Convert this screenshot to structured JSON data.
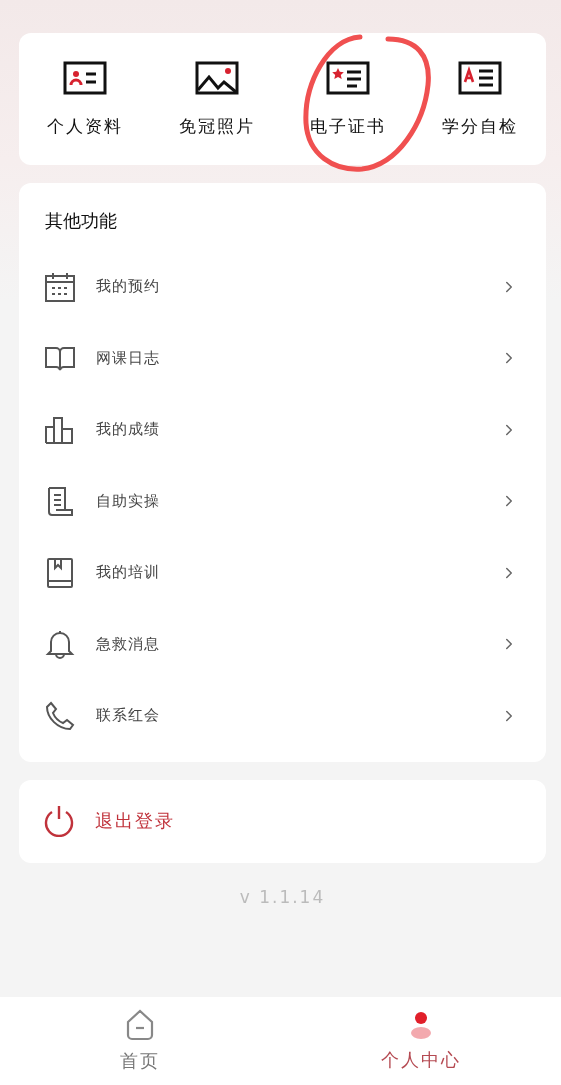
{
  "quick_actions": [
    {
      "label": "个人资料",
      "circled": false
    },
    {
      "label": "免冠照片",
      "circled": false
    },
    {
      "label": "电子证书",
      "circled": true
    },
    {
      "label": "学分自检",
      "circled": false
    }
  ],
  "other_functions": {
    "title": "其他功能",
    "items": [
      {
        "label": "我的预约"
      },
      {
        "label": "网课日志"
      },
      {
        "label": "我的成绩"
      },
      {
        "label": "自助实操"
      },
      {
        "label": "我的培训"
      },
      {
        "label": "急救消息"
      },
      {
        "label": "联系红会"
      }
    ]
  },
  "logout": {
    "label": "退出登录"
  },
  "version": "v 1.1.14",
  "tab_bar": [
    {
      "label": "首页",
      "selected": false
    },
    {
      "label": "个人中心",
      "selected": true
    }
  ]
}
